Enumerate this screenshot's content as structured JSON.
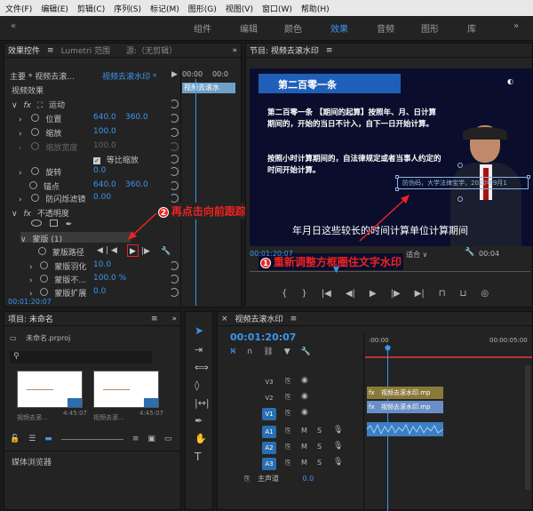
{
  "menu": [
    "文件(F)",
    "编辑(E)",
    "剪辑(C)",
    "序列(S)",
    "标记(M)",
    "图形(G)",
    "视图(V)",
    "窗口(W)",
    "帮助(H)"
  ],
  "workspaces": [
    "组件",
    "编辑",
    "颜色",
    "效果",
    "音频",
    "图形",
    "库"
  ],
  "effect_controls": {
    "tab": "效果控件",
    "tab_lumetri": "Lumetri 范围",
    "tab_source": "源:（无剪辑）",
    "master": "主要 * 视频去滚...",
    "seq": "视频去滚水印 *",
    "t0": "00:00",
    "t1": "00:0",
    "clip_label": "视频去滚水",
    "section_video": "视频效果",
    "motion": "运动",
    "position_label": "位置",
    "position_x": "640.0",
    "position_y": "360.0",
    "scale_label": "缩放",
    "scale_val": "100.0",
    "scale_width_label": "缩放宽度",
    "uniform_scale": "等比缩放",
    "rotation_label": "旋转",
    "rotation_val": "0.0",
    "anchor_label": "锚点",
    "anchor_x": "640.0",
    "anchor_y": "360.0",
    "antiflicker_label": "防闪烁滤镜",
    "antiflicker_val": "0.00",
    "opacity_label": "不透明度",
    "mask_label": "蒙版 (1)",
    "mask_path": "蒙版路径",
    "mask_feather": "蒙版羽化",
    "mask_feather_val": "10.0",
    "mask_opacity": "蒙版不...",
    "mask_opacity_val": "100.0 %",
    "mask_expand": "蒙版扩展",
    "mask_expand_val": "0.0",
    "timecode": "00:01:20:07"
  },
  "program": {
    "title": "节目: 视频去滚水印",
    "slide_title": "第二百零一条",
    "para1": "第二百零一条 【期间的起算】按照年、月、日计算期间的，开始的当日不计入，自下一日开始计算。",
    "para2": "按照小时计算期间的，自法律规定或者当事人约定的时间开始计算。",
    "subtitle": "年月日这些较长的时间计算单位计算期间",
    "watermark": "防伪码，大学法律宝学，2020年9月1",
    "timecode": "00:01:20:07",
    "fit": "适合",
    "time_right": "00:04"
  },
  "callouts": {
    "c1_num": "1",
    "c1_text": "重新调整方框圈住文字水印",
    "c2_num": "2",
    "c2_text": "再点击向前跟踪蒙版"
  },
  "project": {
    "title": "项目: 未命名",
    "file": "未命名.prproj",
    "thumb1_name": "视频去滚...",
    "thumb1_dur": "4:45:07",
    "thumb2_name": "视频去滚...",
    "thumb2_dur": "4:45:07",
    "media_browser": "媒体浏览器"
  },
  "timeline": {
    "title": "视频去滚水印",
    "timecode": "00:01:20:07",
    "ruler0": ":00:00",
    "ruler1": "00:00:05:00",
    "tracks": [
      "V3",
      "V2",
      "V1",
      "A1",
      "A2",
      "A3"
    ],
    "master_label": "主声道",
    "master_val": "0.0",
    "clip_v2": "视频去滚水印.mp",
    "clip_v1": "视频去滚水印.mp"
  },
  "colors": {
    "accent": "#3d96ef",
    "callout": "#e22222"
  }
}
